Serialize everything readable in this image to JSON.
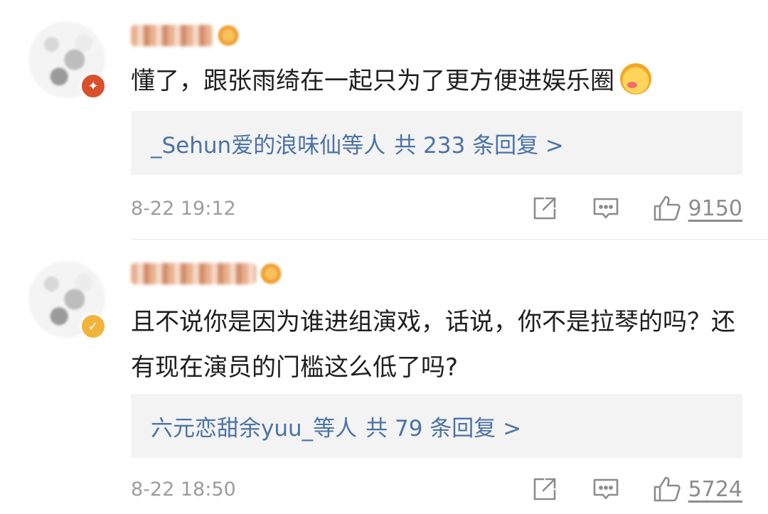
{
  "comments": [
    {
      "text": "懂了，跟张雨绮在一起只为了更方便进娱乐圈",
      "emoji": "face-with-tongue-emoji",
      "replies_users": "_Sehun爱的浪味仙等人",
      "replies_count": "共 233 条回复 >",
      "time": "8-22 19:12",
      "likes": "9150"
    },
    {
      "text": "且不说你是因为谁进组演戏，话说，你不是拉琴的吗？还有现在演员的门槛这么低了吗?",
      "replies_users": "六元恋甜余yuu_等人",
      "replies_count": "共 79 条回复 >",
      "time": "8-22 18:50",
      "likes": "5724"
    }
  ],
  "icons": {
    "share": "share-icon",
    "comment": "comment-icon",
    "like": "thumbs-up-icon"
  },
  "colors": {
    "link": "#4a72a8",
    "meta": "#9c9c9c",
    "reply_bg": "#f3f3f3"
  }
}
